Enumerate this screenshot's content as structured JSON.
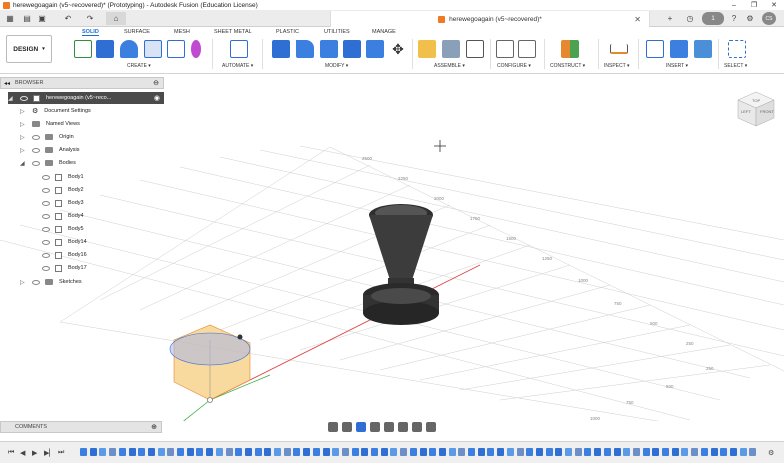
{
  "window": {
    "title": "herewegoagain (v5~recovered)* (Prototyping) - Autodesk Fusion (Education License)",
    "controls": [
      "–",
      "❐",
      "✕"
    ]
  },
  "tabbar": {
    "document_tab": "herewegoagain (v5~recovered)*",
    "badge_count": "1",
    "user_initials": "CS"
  },
  "ribbon": {
    "workspace": "DESIGN",
    "tabs": [
      "SOLID",
      "SURFACE",
      "MESH",
      "SHEET METAL",
      "PLASTIC",
      "UTILITIES",
      "MANAGE"
    ],
    "active_tab": "SOLID",
    "groups": [
      "CREATE ▾",
      "AUTOMATE ▾",
      "MODIFY ▾",
      "ASSEMBLE ▾",
      "CONFIGURE ▾",
      "CONSTRUCT ▾",
      "INSPECT ▾",
      "INSERT ▾",
      "SELECT ▾"
    ]
  },
  "browser": {
    "header": "BROWSER",
    "root": "herewegoagain (v5~reco...",
    "items": [
      {
        "label": "Document Settings"
      },
      {
        "label": "Named Views"
      },
      {
        "label": "Origin"
      },
      {
        "label": "Analysis"
      },
      {
        "label": "Bodies"
      },
      {
        "label": "Body1"
      },
      {
        "label": "Body2"
      },
      {
        "label": "Body3"
      },
      {
        "label": "Body4"
      },
      {
        "label": "Body5"
      },
      {
        "label": "Body14"
      },
      {
        "label": "Body16"
      },
      {
        "label": "Body17"
      },
      {
        "label": "Sketches"
      }
    ]
  },
  "viewcube": {
    "top": "TOP",
    "left": "LEFT",
    "front": "FRONT"
  },
  "grid_labels": [
    "250",
    "500",
    "750",
    "1000",
    "1250",
    "1500",
    "1750",
    "2000",
    "2250",
    "2500",
    "250",
    "500",
    "750",
    "1000",
    "1250",
    "1500",
    "1750",
    "2000",
    "2250",
    "2500"
  ],
  "comments": {
    "header": "COMMENTS"
  },
  "colors": {
    "accent": "#1a6fd0",
    "root_highlight": "#4b4b4b",
    "axis_red": "#e04040",
    "axis_green": "#3cb043",
    "axis_blue": "#3a6fd8",
    "sketch_fill": "#f5c46a",
    "model": "#3c3c3c"
  }
}
